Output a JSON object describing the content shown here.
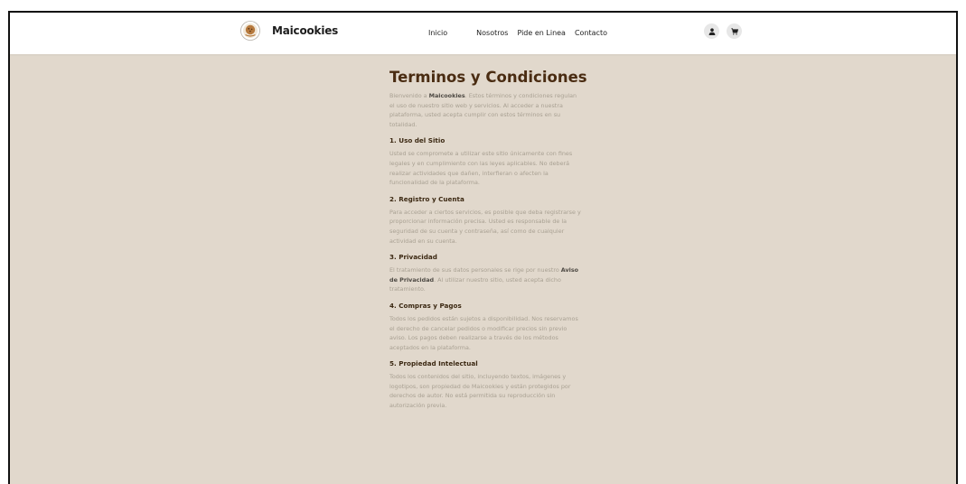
{
  "nav": {
    "brand": "Maicookies",
    "links": [
      "Inicio",
      "Nosotros",
      "Pide en Linea",
      "Contacto"
    ],
    "icons": [
      "user-icon",
      "cart-icon"
    ]
  },
  "page": {
    "title": "Terminos y Condiciones",
    "intro": {
      "before": "Bienvenido a ",
      "bold": "Maicookies",
      "after": ". Estos términos y condiciones regulan el uso de nuestro sitio web y servicios. Al acceder a nuestra plataforma, usted acepta cumplir con estos términos en su totalidad."
    },
    "sections": [
      {
        "title": "1. Uso del Sitio",
        "before": "Usted se compromete a utilizar este sitio únicamente con fines legales y en cumplimiento con las leyes aplicables. No deberá realizar actividades que dañen, interfieran o afecten la funcionalidad de la plataforma.",
        "bold": "",
        "after": ""
      },
      {
        "title": "2. Registro y Cuenta",
        "before": "Para acceder a ciertos servicios, es posible que deba registrarse y proporcionar información precisa. Usted es responsable de la seguridad de su cuenta y contraseña, así como de cualquier actividad en su cuenta.",
        "bold": "",
        "after": ""
      },
      {
        "title": "3. Privacidad",
        "before": "El tratamiento de sus datos personales se rige por nuestro ",
        "bold": "Aviso de Privacidad",
        "after": ". Al utilizar nuestro sitio, usted acepta dicho tratamiento."
      },
      {
        "title": "4. Compras y Pagos",
        "before": "Todos los pedidos están sujetos a disponibilidad. Nos reservamos el derecho de cancelar pedidos o modificar precios sin previo aviso. Los pagos deben realizarse a través de los métodos aceptados en la plataforma.",
        "bold": "",
        "after": ""
      },
      {
        "title": "5. Propiedad Intelectual",
        "before": "Todos los contenidos del sitio, incluyendo textos, imágenes y logotipos, son propiedad de Maicookies y están protegidos por derechos de autor. No está permitida su reproducción sin autorización previa.",
        "bold": "",
        "after": ""
      }
    ]
  }
}
